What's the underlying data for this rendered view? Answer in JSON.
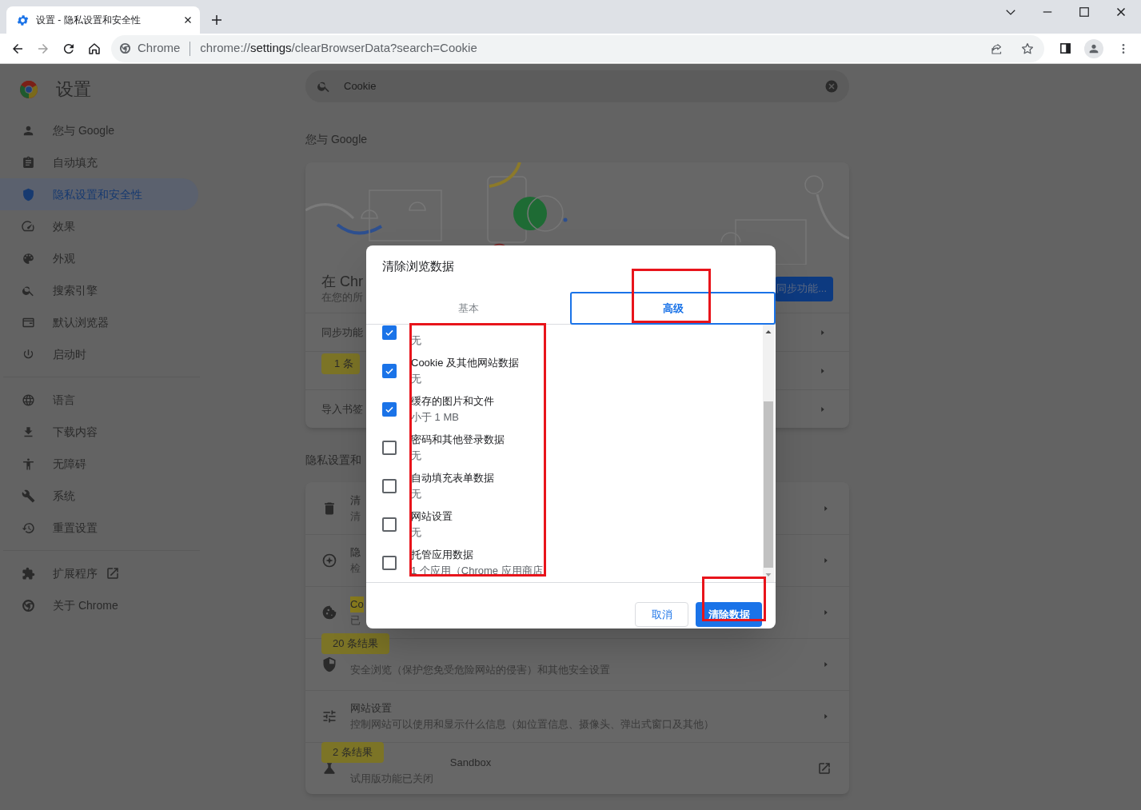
{
  "browser": {
    "tab_title": "设置 - 隐私设置和安全性",
    "site_chip": "Chrome",
    "url": "chrome://**settings**/clearBrowserData?search=Cookie"
  },
  "sidebar": {
    "title": "设置",
    "groups": [
      {
        "items": [
          {
            "label": "您与 Google",
            "selected": false,
            "external": false
          },
          {
            "label": "自动填充",
            "selected": false,
            "external": false
          },
          {
            "label": "隐私设置和安全性",
            "selected": true,
            "external": false
          },
          {
            "label": "效果",
            "selected": false,
            "external": false
          },
          {
            "label": "外观",
            "selected": false,
            "external": false
          },
          {
            "label": "搜索引擎",
            "selected": false,
            "external": false
          },
          {
            "label": "默认浏览器",
            "selected": false,
            "external": false
          },
          {
            "label": "启动时",
            "selected": false,
            "external": false
          }
        ]
      },
      {
        "items": [
          {
            "label": "语言",
            "selected": false,
            "external": false
          },
          {
            "label": "下载内容",
            "selected": false,
            "external": false
          },
          {
            "label": "无障碍",
            "selected": false,
            "external": false
          },
          {
            "label": "系统",
            "selected": false,
            "external": false
          },
          {
            "label": "重置设置",
            "selected": false,
            "external": false
          }
        ]
      },
      {
        "items": [
          {
            "label": "扩展程序",
            "selected": false,
            "external": true
          },
          {
            "label": "关于 Chrome",
            "selected": false,
            "external": false
          }
        ]
      }
    ]
  },
  "search": {
    "value": "Cookie"
  },
  "you_and_google": {
    "heading": "您与 Google",
    "title": "在 Chr",
    "subtitle": "在您的所",
    "sync_button": "同步功能...",
    "rows": [
      {
        "kind": "text",
        "text": "同步功能"
      },
      {
        "kind": "badge",
        "text": "1 条"
      },
      {
        "kind": "text",
        "text": "导入书签"
      }
    ]
  },
  "privacy": {
    "heading": "隐私设置和",
    "rows": [
      {
        "kind": "link",
        "title": "清",
        "subtitle": "清",
        "highlighted": false
      },
      {
        "kind": "link",
        "title": "隐",
        "subtitle": "检",
        "highlighted": false
      },
      {
        "kind": "link",
        "title": "Co",
        "subtitle": "已",
        "highlighted": true
      },
      {
        "kind": "link",
        "badge": "20 条结果",
        "subtitle": "安全浏览（保护您免受危险网站的侵害）和其他安全设置"
      },
      {
        "kind": "link",
        "title": "网站设置",
        "subtitle": "控制网站可以使用和显示什么信息（如位置信息、摄像头、弹出式窗口及其他）",
        "highlighted": false
      },
      {
        "kind": "external",
        "badge": "2 条结果",
        "title": "Sandbox",
        "subtitle": "试用版功能已关闭",
        "highlighted": false
      }
    ]
  },
  "dialog": {
    "title": "清除浏览数据",
    "tabs": [
      {
        "label": "基本",
        "selected": false
      },
      {
        "label": "高级",
        "selected": true
      }
    ],
    "items": [
      {
        "subtitle": "无",
        "checked": true
      },
      {
        "title": "Cookie 及其他网站数据",
        "subtitle": "无",
        "checked": true
      },
      {
        "title": "缓存的图片和文件",
        "subtitle": "小于 1 MB",
        "checked": true
      },
      {
        "title": "密码和其他登录数据",
        "subtitle": "无",
        "checked": false
      },
      {
        "title": "自动填充表单数据",
        "subtitle": "无",
        "checked": false
      },
      {
        "title": "网站设置",
        "subtitle": "无",
        "checked": false
      },
      {
        "title": "托管应用数据",
        "subtitle": "1 个应用（Chrome 应用商店",
        "checked": false
      }
    ],
    "cancel": "取消",
    "confirm": "清除数据"
  }
}
